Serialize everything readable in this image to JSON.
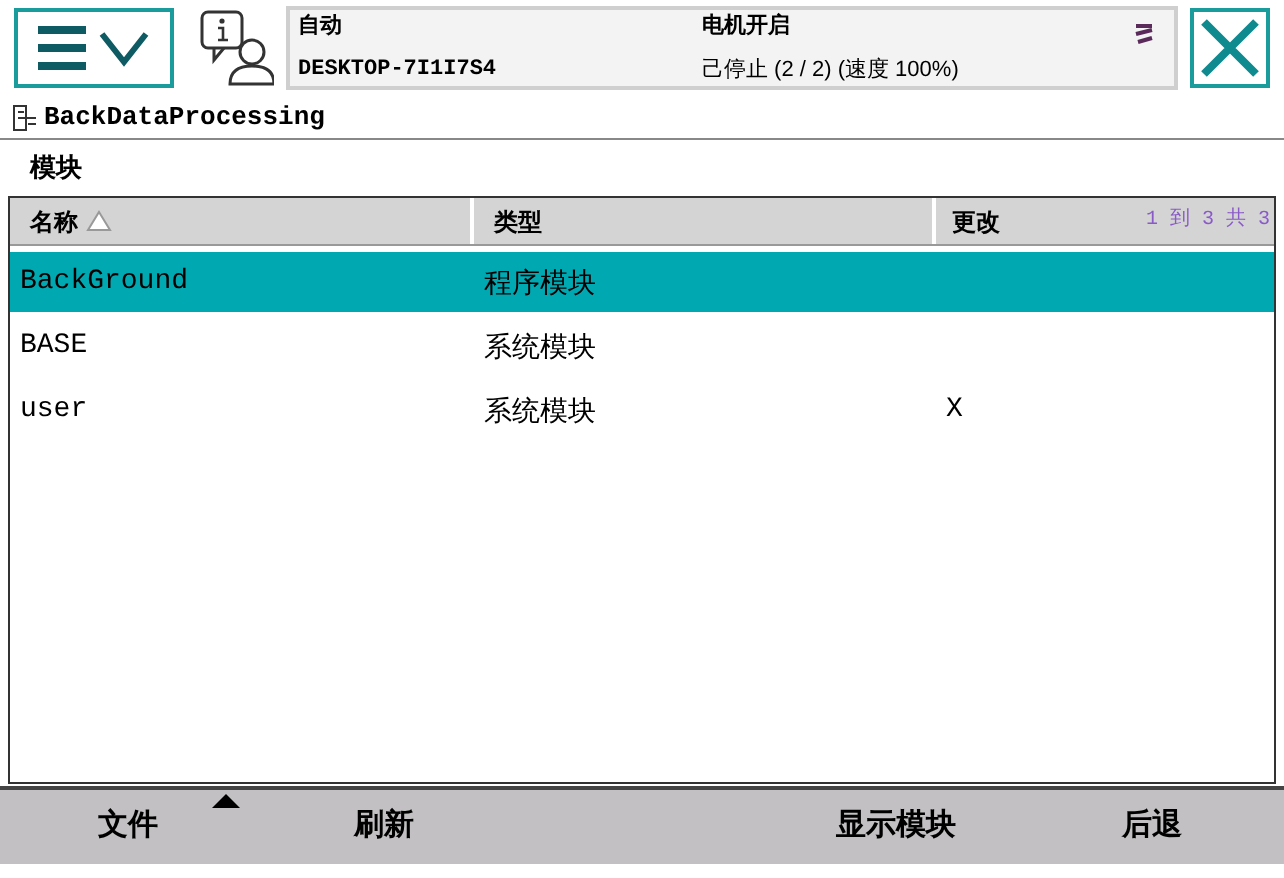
{
  "status": {
    "mode": "自动",
    "controller": "DESKTOP-7I1I7S4",
    "motors": "电机开启",
    "state": "己停止 (2 / 2) (速度 100%)"
  },
  "title": "BackDataProcessing",
  "section": "模块",
  "table": {
    "columns": [
      {
        "label": "名称",
        "sorted": true
      },
      {
        "label": "类型",
        "sorted": false
      },
      {
        "label": "更改",
        "sorted": false
      }
    ],
    "pager": "1 到 3 共 3",
    "rows": [
      {
        "cells": [
          "BackGround",
          "程序模块",
          ""
        ],
        "selected": true
      },
      {
        "cells": [
          "BASE",
          "系统模块",
          ""
        ],
        "selected": false
      },
      {
        "cells": [
          "user",
          "系统模块",
          "X"
        ],
        "selected": false
      }
    ]
  },
  "footer": [
    {
      "label": "文件",
      "menu": true
    },
    {
      "label": "刷新",
      "menu": false
    },
    {
      "label": "显示模块",
      "menu": false
    },
    {
      "label": "后退",
      "menu": false
    }
  ]
}
